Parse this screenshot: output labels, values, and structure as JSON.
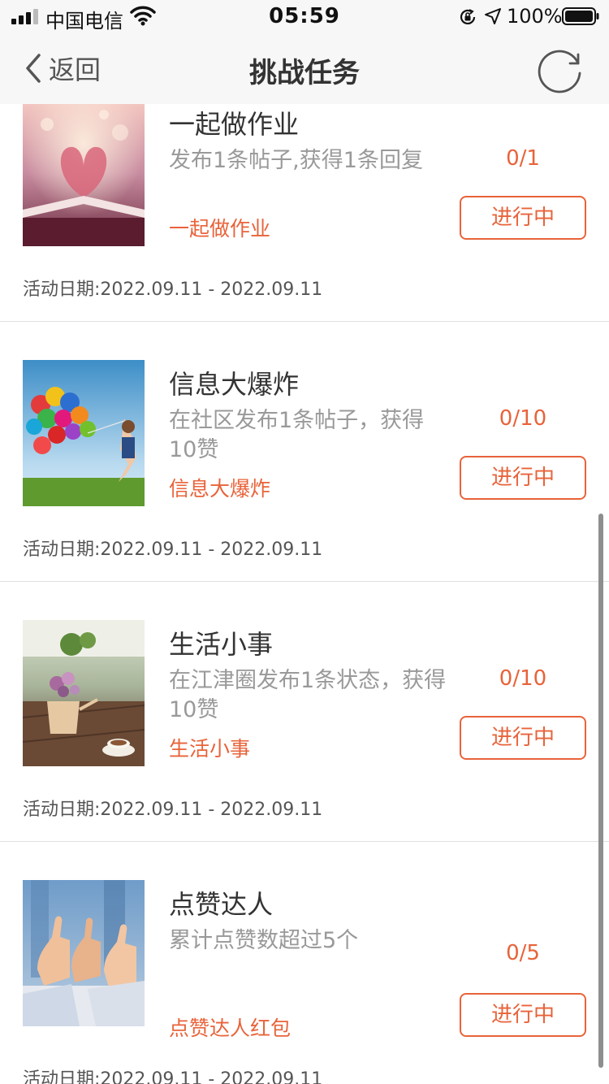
{
  "status_bar": {
    "carrier": "中国电信",
    "time": "05:59",
    "battery": "100%",
    "icons": [
      "signal-icon",
      "wifi-icon",
      "rotation-lock-icon",
      "location-icon",
      "battery-icon"
    ]
  },
  "nav": {
    "back_label": "返回",
    "title": "挑战任务",
    "refresh_icon": "refresh-icon"
  },
  "colors": {
    "accent": "#e8633a",
    "nav_bg": "#f7f7f7",
    "divider": "#e0e0e0"
  },
  "tasks": [
    {
      "title": "一起做作业",
      "description": "发布1条帖子,获得1条回复",
      "tag": "一起做作业",
      "progress": "0/1",
      "status": "进行中",
      "date_label": "活动日期:",
      "date_range": "2022.09.11 - 2022.09.11",
      "image": "open-book-heart-photo"
    },
    {
      "title": "信息大爆炸",
      "description": "在社区发布1条帖子，获得10赞",
      "tag": "信息大爆炸",
      "progress": "0/10",
      "status": "进行中",
      "date_label": "活动日期:",
      "date_range": "2022.09.11 - 2022.09.11",
      "image": "child-with-balloons-photo"
    },
    {
      "title": "生活小事",
      "description": "在江津圈发布1条状态，获得10赞",
      "tag": "生活小事",
      "progress": "0/10",
      "status": "进行中",
      "date_label": "活动日期:",
      "date_range": "2022.09.11 - 2022.09.11",
      "image": "flowers-and-coffee-photo"
    },
    {
      "title": "点赞达人",
      "description": "累计点赞数超过5个",
      "tag": "点赞达人红包",
      "progress": "0/5",
      "status": "进行中",
      "date_label": "活动日期:",
      "date_range": "2022.09.11 - 2022.09.11",
      "image": "thumbs-up-hands-photo"
    }
  ]
}
